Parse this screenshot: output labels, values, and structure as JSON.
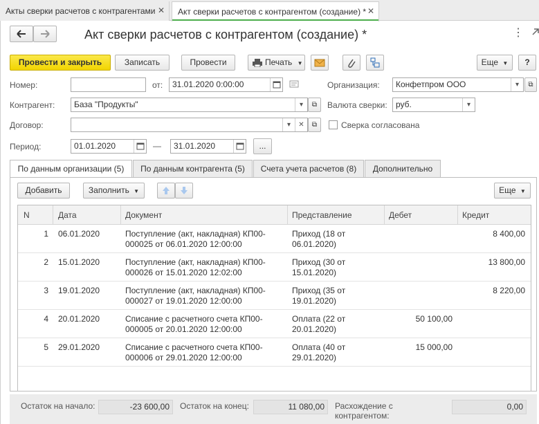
{
  "window_tabs": [
    {
      "label": "Акты сверки расчетов с контрагентами"
    },
    {
      "label": "Акт сверки расчетов с контрагентом (создание) *"
    }
  ],
  "form": {
    "title": "Акт сверки расчетов с контрагентом (создание) *"
  },
  "toolbar": {
    "post_close": "Провести и закрыть",
    "save": "Записать",
    "post": "Провести",
    "print": "Печать",
    "more": "Еще",
    "help": "?"
  },
  "fields": {
    "number_label": "Номер:",
    "number_value": "",
    "date_label": "от:",
    "date_value": "31.01.2020  0:00:00",
    "org_label": "Организация:",
    "org_value": "Конфетпром ООО",
    "counterparty_label": "Контрагент:",
    "counterparty_value": "База \"Продукты\"",
    "currency_label": "Валюта сверки:",
    "currency_value": "руб.",
    "contract_label": "Договор:",
    "contract_value": "",
    "agreed_label": "Сверка согласована",
    "period_label": "Период:",
    "period_from": "01.01.2020",
    "period_dash": "—",
    "period_to": "31.01.2020",
    "period_more": "..."
  },
  "form_tabs": [
    {
      "label": "По данным организации (5)"
    },
    {
      "label": "По данным контрагента (5)"
    },
    {
      "label": "Счета учета расчетов (8)"
    },
    {
      "label": "Дополнительно"
    }
  ],
  "table_toolbar": {
    "add": "Добавить",
    "fill": "Заполнить",
    "more": "Еще"
  },
  "table": {
    "columns": [
      "N",
      "Дата",
      "Документ",
      "Представление",
      "Дебет",
      "Кредит"
    ],
    "rows": [
      {
        "n": "1",
        "date": "06.01.2020",
        "doc1": "Поступление (акт, накладная) КП00-",
        "doc2": "000025 от 06.01.2020 12:00:00",
        "rep1": "Приход (18 от",
        "rep2": "06.01.2020)",
        "debit": "",
        "credit": "8 400,00"
      },
      {
        "n": "2",
        "date": "15.01.2020",
        "doc1": "Поступление (акт, накладная) КП00-",
        "doc2": "000026 от 15.01.2020 12:02:00",
        "rep1": "Приход (30 от",
        "rep2": "15.01.2020)",
        "debit": "",
        "credit": "13 800,00"
      },
      {
        "n": "3",
        "date": "19.01.2020",
        "doc1": "Поступление (акт, накладная) КП00-",
        "doc2": "000027 от 19.01.2020 12:00:00",
        "rep1": "Приход (35 от",
        "rep2": "19.01.2020)",
        "debit": "",
        "credit": "8 220,00"
      },
      {
        "n": "4",
        "date": "20.01.2020",
        "doc1": "Списание с расчетного счета КП00-",
        "doc2": "000005 от 20.01.2020 12:00:00",
        "rep1": "Оплата (22 от",
        "rep2": "20.01.2020)",
        "debit": "50 100,00",
        "credit": ""
      },
      {
        "n": "5",
        "date": "29.01.2020",
        "doc1": "Списание с расчетного счета КП00-",
        "doc2": "000006 от 29.01.2020 12:00:00",
        "rep1": "Оплата (40 от",
        "rep2": "29.01.2020)",
        "debit": "15 000,00",
        "credit": ""
      }
    ]
  },
  "footer": {
    "start_label": "Остаток на начало:",
    "start_value": "-23 600,00",
    "end_label": "Остаток на конец:",
    "end_value": "11 080,00",
    "diff_label1": "Расхождение с",
    "diff_label2": "контрагентом:",
    "diff_value": "0,00"
  },
  "colors": {
    "primary_button": "#f2d500",
    "active_tab_underline": "#4cae4c"
  }
}
